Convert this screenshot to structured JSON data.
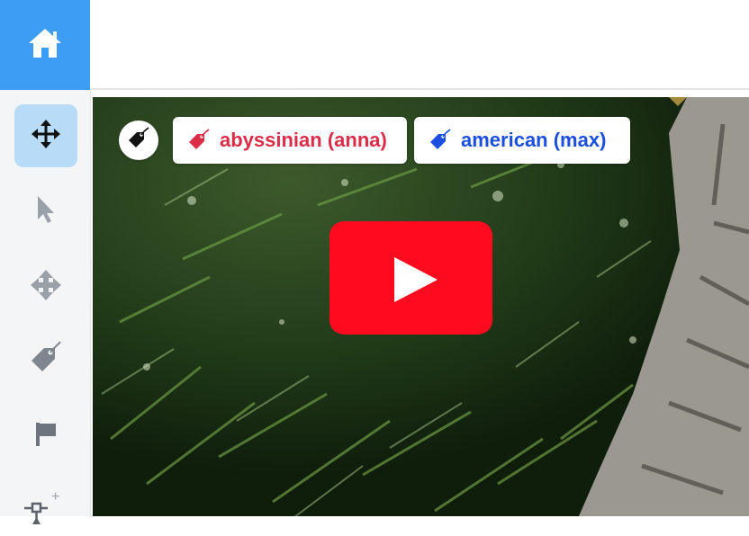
{
  "colors": {
    "accent": "#3d9df5",
    "active_tool_bg": "#b8dcf8",
    "sidebar_bg": "#f4f5f7",
    "label_red": "#dc2d48",
    "label_blue": "#1a4fe0",
    "play_red": "#ff0a1f"
  },
  "sidebar": {
    "home_icon": "home-icon",
    "tools": [
      {
        "name": "move-tool",
        "icon": "move-arrows-icon",
        "active": true
      },
      {
        "name": "select-tool",
        "icon": "cursor-icon",
        "active": false
      },
      {
        "name": "pan-tool",
        "icon": "pan-arrows-icon",
        "active": false
      },
      {
        "name": "tag-tool",
        "icon": "tag-icon",
        "active": false
      },
      {
        "name": "flag-tool",
        "icon": "flag-icon",
        "active": false
      },
      {
        "name": "add-keypoint-tool",
        "icon": "keypoint-add-icon",
        "active": false
      }
    ]
  },
  "labels": [
    {
      "text": "abyssinian (anna)",
      "color": "#dc2d48"
    },
    {
      "text": "american (max)",
      "color": "#1a4fe0"
    }
  ],
  "video": {
    "play_icon": "youtube-play-icon"
  }
}
